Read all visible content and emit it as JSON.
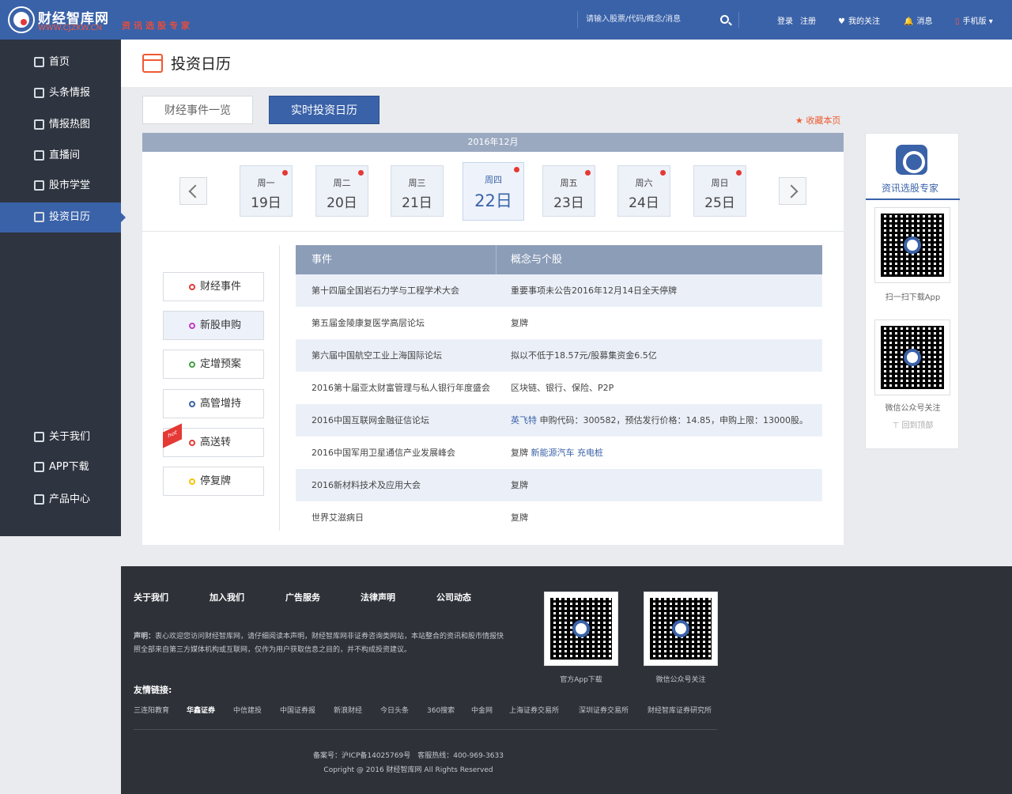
{
  "brand": {
    "name": "财经智库网",
    "domain_prefix": "WWW.",
    "domain_mid": "CJZKW",
    "domain_suffix": ".CN",
    "slogan": "资讯选股专家"
  },
  "header": {
    "search_placeholder": "请输入股票/代码/概念/消息",
    "login": "登录",
    "register": "注册",
    "follow": "我的关注",
    "message": "消息",
    "mobile": "手机版"
  },
  "sidebar": {
    "items": [
      {
        "label": "首页",
        "icon": "home-icon"
      },
      {
        "label": "头条情报",
        "icon": "edit-icon"
      },
      {
        "label": "情报热图",
        "icon": "pie-chart-icon"
      },
      {
        "label": "直播间",
        "icon": "live-icon"
      },
      {
        "label": "股市学堂",
        "icon": "play-icon"
      },
      {
        "label": "投资日历",
        "icon": "calendar-icon"
      }
    ],
    "bottom": [
      {
        "label": "关于我们",
        "icon": "about-icon"
      },
      {
        "label": "APP下载",
        "icon": "download-icon"
      },
      {
        "label": "产品中心",
        "icon": "tools-icon"
      }
    ]
  },
  "main": {
    "title": "投资日历",
    "tabs": [
      "财经事件一览",
      "实时投资日历"
    ],
    "bookmark": "收藏本页",
    "month": "2016年12月"
  },
  "calendar": {
    "days": [
      {
        "week": "周一",
        "date": "19日"
      },
      {
        "week": "周二",
        "date": "20日"
      },
      {
        "week": "周三",
        "date": "21日"
      },
      {
        "week": "周四",
        "date": "22日"
      },
      {
        "week": "周五",
        "date": "23日"
      },
      {
        "week": "周六",
        "date": "24日"
      },
      {
        "week": "周日",
        "date": "25日"
      }
    ]
  },
  "filters": [
    {
      "label": "财经事件",
      "color": "#e53935"
    },
    {
      "label": "新股申购",
      "color": "#c53ac5"
    },
    {
      "label": "定增预案",
      "color": "#43a047"
    },
    {
      "label": "高管增持",
      "color": "#3a62a8"
    },
    {
      "label": "高送转",
      "color": "#e53935",
      "hot": "hot"
    },
    {
      "label": "停复牌",
      "color": "#f2c400"
    }
  ],
  "table": {
    "headers": [
      "事件",
      "概念与个股"
    ],
    "rows": [
      {
        "event": "第十四届全国岩石力学与工程学术大会",
        "concept": "重要事项未公告2016年12月14日全天停牌"
      },
      {
        "event": "第五届金陵康复医学高层论坛",
        "concept": "复牌"
      },
      {
        "event": "第六届中国航空工业上海国际论坛",
        "concept": "拟以不低于18.57元/股募集资金6.5亿"
      },
      {
        "event": "2016第十届亚太财富管理与私人银行年度盛会",
        "concept": "区块链、银行、保险、P2P"
      },
      {
        "event": "2016中国互联网金融征信论坛",
        "concept_link": "英飞特",
        "concept": " 申购代码：300582，预估发行价格：14.85，申购上限：13000股。"
      },
      {
        "event": "2016中国军用卫星通信产业发展峰会",
        "concept": "复牌 ",
        "concept_link": "新能源汽车 充电桩"
      },
      {
        "event": "2016新材料技术及应用大会",
        "concept": "复牌"
      },
      {
        "event": "世界艾滋病日",
        "concept": "复牌"
      }
    ]
  },
  "right_panel": {
    "title": "资讯选股专家",
    "qr1": "扫一扫下载App",
    "qr2": "微信公众号关注",
    "backtop": "回到顶部"
  },
  "footer": {
    "links": [
      "关于我们",
      "加入我们",
      "广告服务",
      "法律声明",
      "公司动态"
    ],
    "statement_label": "声明：",
    "statement": "衷心欢迎您访问财经智库网，请仔细阅读本声明，财经智库网非证券咨询类网站，本站整合的资讯和股市情报快照全部来自第三方媒体机构或互联网，仅作为用户获取信息之目的，并不构成投资建议。",
    "friend_title": "友情链接:",
    "friends": [
      "三连阳教育",
      "华鑫证券",
      "中信建投",
      "中国证券报",
      "新浪财经",
      "今日头条",
      "360搜索",
      "中金网",
      "上海证券交易所",
      "深圳证券交易所",
      "财经智库证券研究所"
    ],
    "qr_app": "官方App下载",
    "qr_wechat": "微信公众号关注",
    "icp": "备案号：沪ICP备14025769号",
    "service": "客服热线：400-969-3633",
    "copyright": "Copright @ 2016 财经智库网 All Rights Reserved"
  }
}
